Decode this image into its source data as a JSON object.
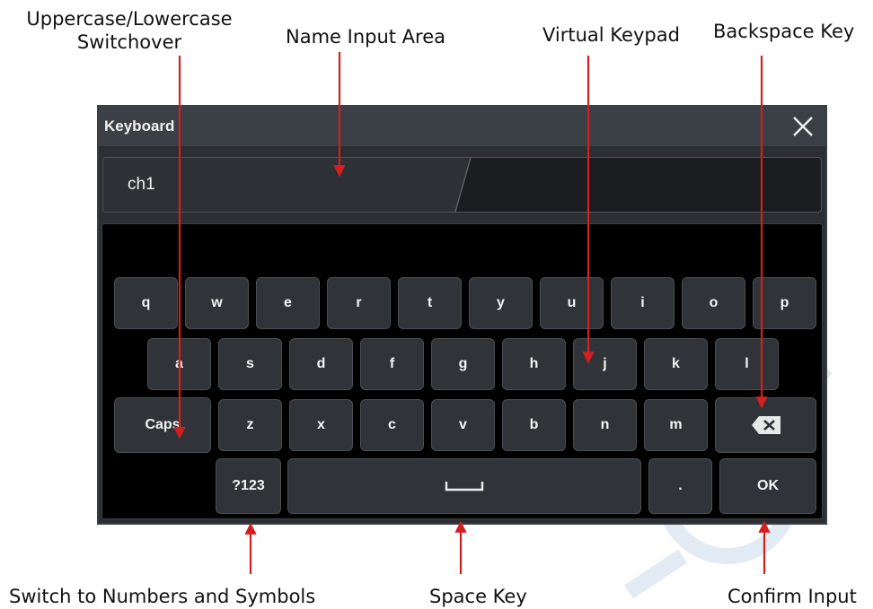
{
  "callouts": {
    "case_switch_line1": "Uppercase/Lowercase",
    "case_switch_line2": "Switchover",
    "name_input_area": "Name Input Area",
    "virtual_keypad": "Virtual Keypad",
    "backspace_key": "Backspace Key",
    "switch_numbers": "Switch to Numbers and Symbols",
    "space_key": "Space Key",
    "confirm_input": "Confirm Input"
  },
  "dialog": {
    "title": "Keyboard",
    "input_value": "ch1"
  },
  "keys": {
    "row1": [
      "q",
      "w",
      "e",
      "r",
      "t",
      "y",
      "u",
      "i",
      "o",
      "p"
    ],
    "row2": [
      "a",
      "s",
      "d",
      "f",
      "g",
      "h",
      "j",
      "k",
      "l"
    ],
    "caps": "Caps",
    "row3": [
      "z",
      "x",
      "c",
      "v",
      "b",
      "n",
      "m"
    ],
    "sym": "?123",
    "period": ".",
    "ok": "OK"
  },
  "colors": {
    "arrow": "#d31f1f",
    "dialog_bg": "#2b2f33",
    "key_bg": "#303438",
    "keypad_bg": "#000000",
    "watermark": "#dfe8f2"
  },
  "icons": {
    "close": "close-icon",
    "backspace": "backspace-icon",
    "space": "space-bar-icon"
  }
}
